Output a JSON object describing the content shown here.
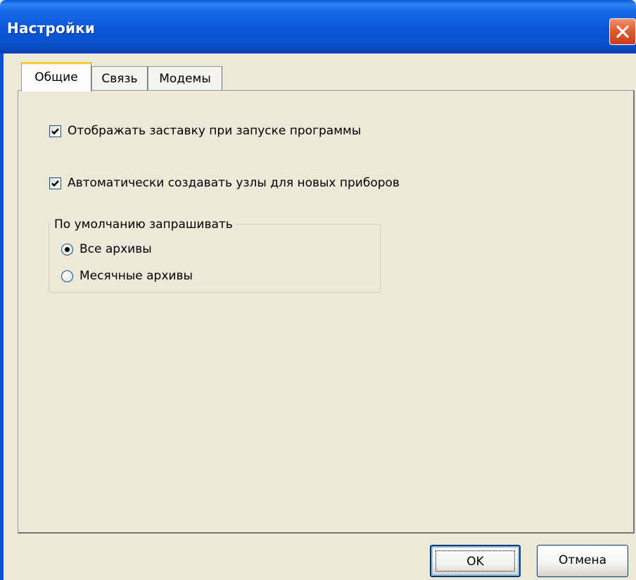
{
  "window": {
    "title": "Настройки",
    "close_icon": "close-icon"
  },
  "tabs": [
    {
      "label": "Общие",
      "active": true
    },
    {
      "label": "Связь",
      "active": false
    },
    {
      "label": "Модемы",
      "active": false
    }
  ],
  "general": {
    "show_splash": {
      "label": "Отображать заставку при запуске программы",
      "checked": true
    },
    "auto_create_nodes": {
      "label": "Автоматически создавать узлы для новых приборов",
      "checked": true
    },
    "default_request": {
      "label": "По умолчанию запрашивать",
      "options": [
        {
          "label": "Все архивы",
          "selected": true
        },
        {
          "label": "Месячные архивы",
          "selected": false
        }
      ]
    }
  },
  "buttons": {
    "ok_label": "OK",
    "cancel_label": "Отмена"
  },
  "colors": {
    "title_bar": "#0a57d8",
    "dialog_background": "#ece9d8",
    "close_button": "#e35b2f",
    "active_tab_highlight": "#ffc83c"
  }
}
